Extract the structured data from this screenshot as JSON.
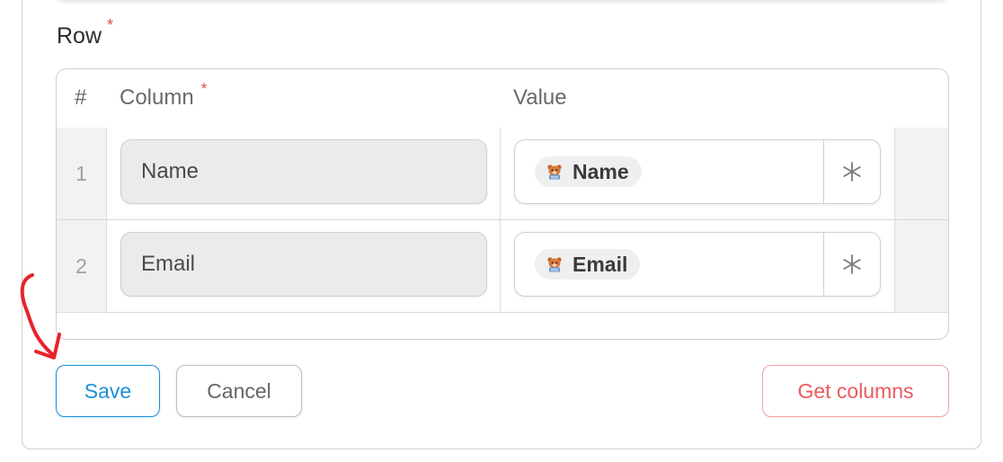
{
  "section": {
    "label": "Row",
    "required_mark": "*"
  },
  "table": {
    "headers": {
      "index": "#",
      "column": "Column",
      "column_required": "*",
      "value": "Value"
    },
    "rows": [
      {
        "index": "1",
        "column": "Name",
        "value_tag": "Name",
        "tag_icon": "wpforms-bear-icon",
        "smart_tag_icon": "asterisk-icon"
      },
      {
        "index": "2",
        "column": "Email",
        "value_tag": "Email",
        "tag_icon": "wpforms-bear-icon",
        "smart_tag_icon": "asterisk-icon"
      }
    ]
  },
  "actions": {
    "save": "Save",
    "cancel": "Cancel",
    "get_columns": "Get columns"
  },
  "annotation": {
    "icon": "red-curved-arrow-icon",
    "color": "#e8232a"
  },
  "colors": {
    "primary": "#1a8fd8",
    "danger": "#ea5a5f",
    "required": "#e0474c"
  }
}
